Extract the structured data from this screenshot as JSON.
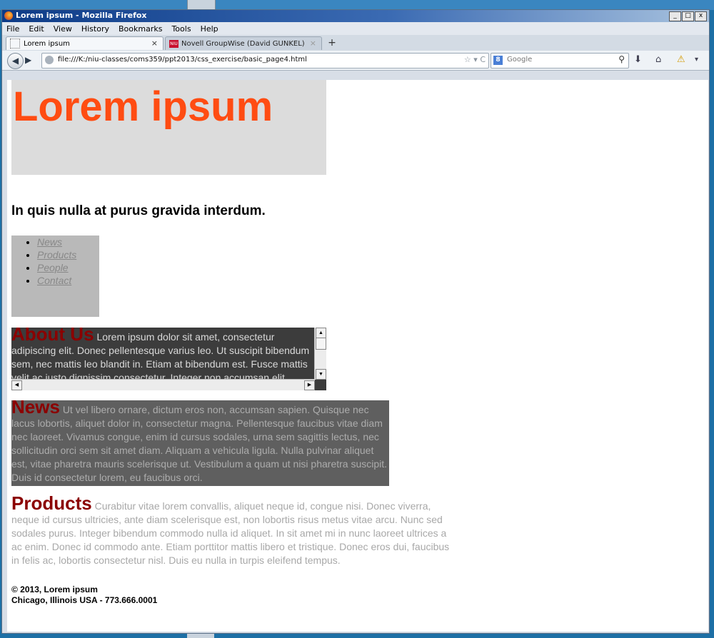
{
  "window": {
    "title": "Lorem ipsum - Mozilla Firefox",
    "controls": {
      "minimize": "_",
      "maximize": "□",
      "close": "x"
    }
  },
  "menu": [
    "File",
    "Edit",
    "View",
    "History",
    "Bookmarks",
    "Tools",
    "Help"
  ],
  "tabs": [
    {
      "label": "Lorem ipsum",
      "close": "×",
      "active": true
    },
    {
      "label": "Novell GroupWise (David GUNKEL)",
      "close": "×",
      "favicon": "NIU"
    }
  ],
  "new_tab": "+",
  "nav": {
    "url": "file:///K:/niu-classes/coms359/ppt2013/css_exercise/basic_page4.html",
    "search_placeholder": "Google",
    "search_engine_icon": "8"
  },
  "page": {
    "hero_title": "Lorem ipsum",
    "subhead": "In quis nulla at purus gravida interdum.",
    "nav_links": [
      "News",
      "Products",
      "People",
      "Contact"
    ],
    "about": {
      "heading": "About Us",
      "body": "Lorem ipsum dolor sit amet, consectetur adipiscing elit. Donec pellentesque varius leo. Ut suscipit bibendum sem, nec mattis leo blandit in. Etiam at bibendum est. Fusce mattis velit ac justo dignissim consectetur. Integer non accumsan elit."
    },
    "news": {
      "heading": "News",
      "body": "Ut vel libero ornare, dictum eros non, accumsan sapien. Quisque nec lacus lobortis, aliquet dolor in, consectetur magna. Pellentesque faucibus vitae diam nec laoreet. Vivamus congue, enim id cursus sodales, urna sem sagittis lectus, nec sollicitudin orci sem sit amet diam. Aliquam a vehicula ligula. Nulla pulvinar aliquet est, vitae pharetra mauris scelerisque ut. Vestibulum a quam ut nisi pharetra suscipit. Duis id consectetur lorem, eu faucibus orci."
    },
    "products": {
      "heading": "Products",
      "body": "Curabitur vitae lorem convallis, aliquet neque id, congue nisi. Donec viverra, neque id cursus ultricies, ante diam scelerisque est, non lobortis risus metus vitae arcu. Nunc sed sodales purus. Integer bibendum commodo nulla id aliquet. In sit amet mi in nunc laoreet ultrices a ac enim. Donec id commodo ante. Etiam porttitor mattis libero et tristique. Donec eros dui, faucibus in felis ac, lobortis consectetur nisl. Duis eu nulla in turpis eleifend tempus."
    },
    "footer": {
      "line1": "© 2013, Lorem ipsum",
      "line2": "Chicago, Illinois USA - 773.666.0001"
    }
  },
  "colors": {
    "hero_title": "#ff4c12",
    "section_heading": "#8b0000",
    "hero_bg": "#dcdcdc",
    "about_bg": "#3c3c3c",
    "news_bg": "#5f5f5f",
    "nav_bg": "#b9b9b9"
  }
}
